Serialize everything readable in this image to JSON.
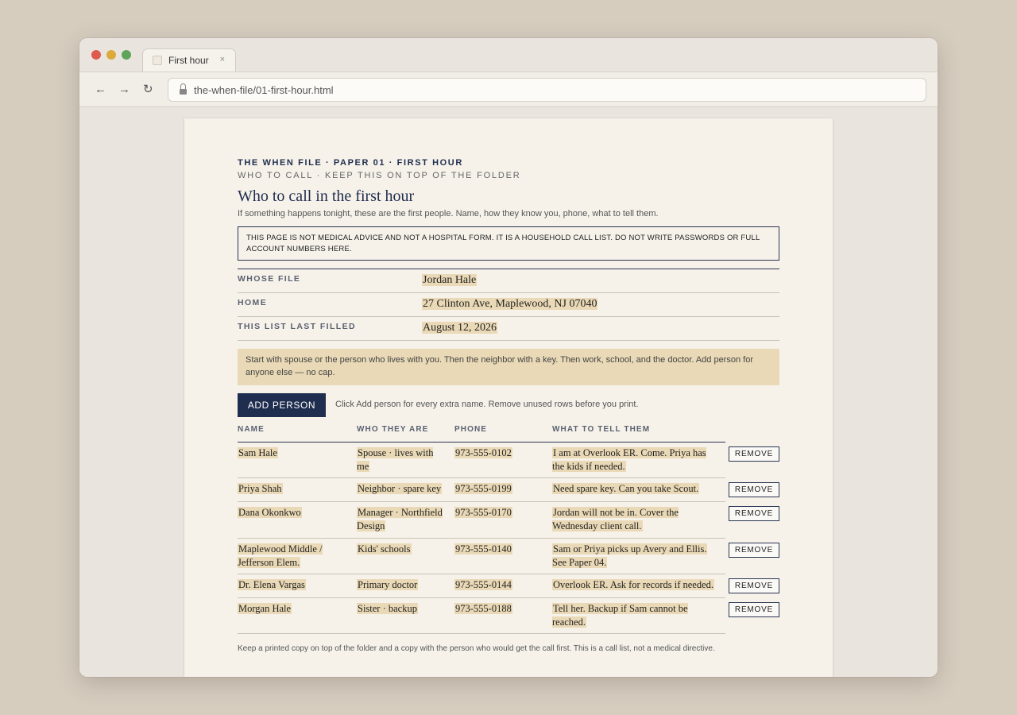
{
  "browser": {
    "tab_title": "First hour",
    "tab_close": "×",
    "url": "the-when-file/01-first-hour.html",
    "nav_back": "←",
    "nav_forward": "→",
    "nav_reload": "↻"
  },
  "page": {
    "eyebrow": "THE WHEN FILE · PAPER 01 · FIRST HOUR",
    "subeyebrow": "WHO TO CALL · KEEP THIS ON TOP OF THE FOLDER",
    "title": "Who to call in the first hour",
    "lede": "If something happens tonight, these are the first people. Name, how they know you, phone, what to tell them.",
    "notice": "THIS PAGE IS NOT MEDICAL ADVICE AND NOT A HOSPITAL FORM. IT IS A HOUSEHOLD CALL LIST. DO NOT WRITE PASSWORDS OR FULL ACCOUNT NUMBERS HERE.",
    "fields": [
      {
        "label": "WHOSE FILE",
        "value": "Jordan Hale"
      },
      {
        "label": "HOME",
        "value": "27 Clinton Ave, Maplewood, NJ 07040"
      },
      {
        "label": "THIS LIST LAST FILLED",
        "value": "August 12, 2026"
      }
    ],
    "callout": "Start with spouse or the person who lives with you. Then the neighbor with a key. Then work, school, and the doctor. Add person for anyone else — no cap.",
    "add_button": "ADD PERSON",
    "add_hint": "Click Add person for every extra name. Remove unused rows before you print.",
    "columns": {
      "name": "NAME",
      "who": "WHO THEY ARE",
      "phone": "PHONE",
      "tell": "WHAT TO TELL THEM"
    },
    "remove_label": "REMOVE",
    "rows": [
      {
        "name": "Sam Hale",
        "who": "Spouse · lives with me",
        "phone": "973-555-0102",
        "tell": "I am at Overlook ER. Come. Priya has the kids if needed."
      },
      {
        "name": "Priya Shah",
        "who": "Neighbor · spare key",
        "phone": "973-555-0199",
        "tell": "Need spare key. Can you take Scout."
      },
      {
        "name": "Dana Okonkwo",
        "who": "Manager · Northfield Design",
        "phone": "973-555-0170",
        "tell": "Jordan will not be in. Cover the Wednesday client call."
      },
      {
        "name": "Maplewood Middle / Jefferson Elem.",
        "who": "Kids' schools",
        "phone": "973-555-0140",
        "tell": "Sam or Priya picks up Avery and Ellis. See Paper 04."
      },
      {
        "name": "Dr. Elena Vargas",
        "who": "Primary doctor",
        "phone": "973-555-0144",
        "tell": "Overlook ER. Ask for records if needed."
      },
      {
        "name": "Morgan Hale",
        "who": "Sister · backup",
        "phone": "973-555-0188",
        "tell": "Tell her. Backup if Sam cannot be reached."
      }
    ],
    "footnote": "Keep a printed copy on top of the folder and a copy with the person who would get the call first. This is a call list, not a medical directive."
  }
}
